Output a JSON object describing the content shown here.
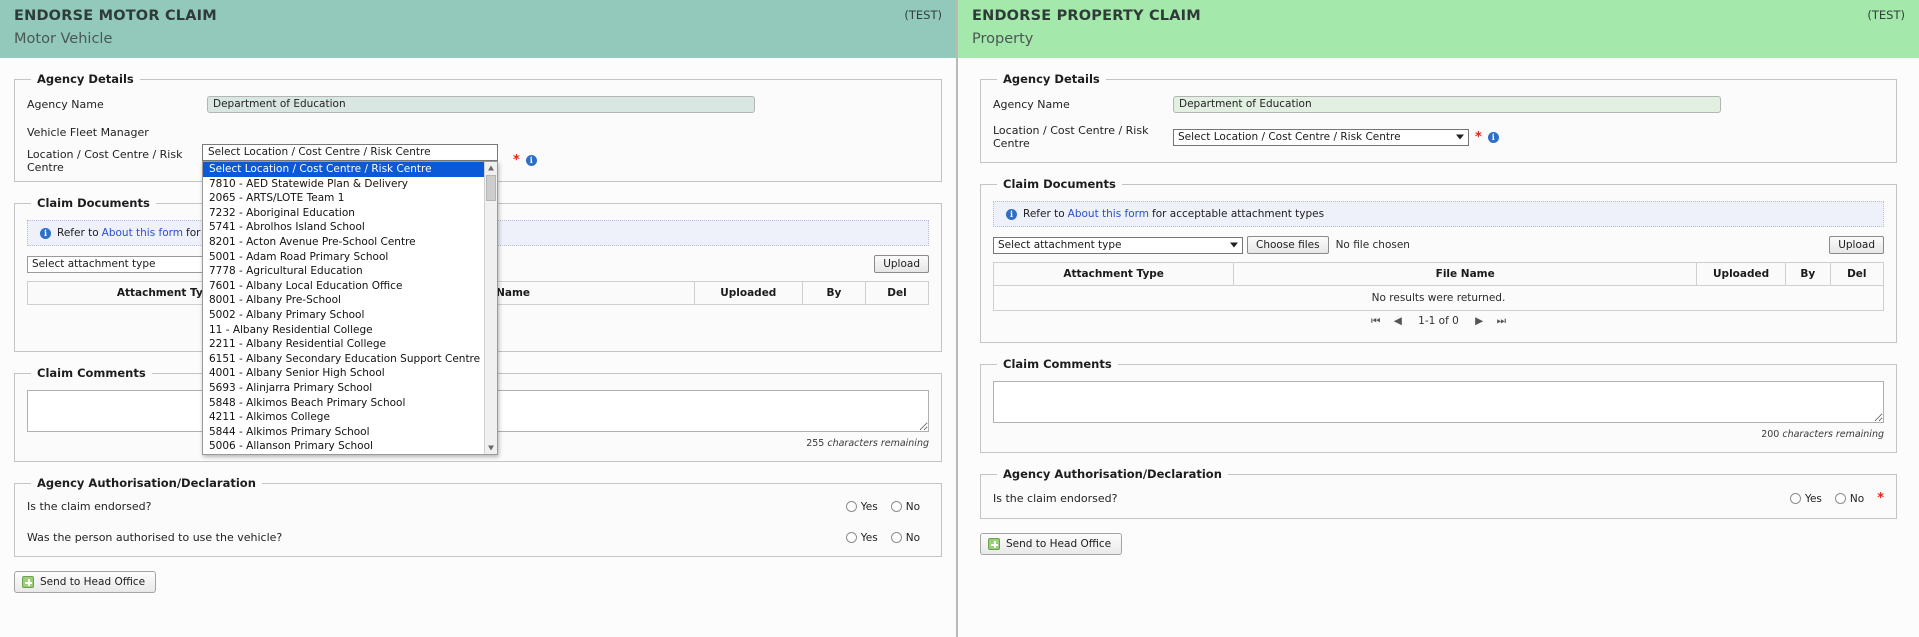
{
  "motor": {
    "banner": {
      "title": "ENDORSE MOTOR CLAIM",
      "subtitle": "Motor Vehicle",
      "test": "(TEST)"
    },
    "agency_details": {
      "legend": "Agency Details",
      "agency_name_label": "Agency Name",
      "agency_name_value": "Department of Education",
      "fleet_manager_label": "Vehicle Fleet Manager",
      "fleet_manager_value": "",
      "location_label": "Location / Cost Centre / Risk Centre",
      "location_value": "Select Location / Cost Centre / Risk Centre",
      "required_marker": "*",
      "info_icon_label": "i"
    },
    "location_dropdown": {
      "closed_value": "Select Location / Cost Centre / Risk Centre",
      "options": [
        "Select Location / Cost Centre / Risk Centre",
        "7810 - AED Statewide Plan & Delivery",
        "2065 - ARTS/LOTE Team 1",
        "7232 - Aboriginal Education",
        "5741 - Abrolhos Island School",
        "8201 - Acton Avenue Pre-School Centre",
        "5001 - Adam Road Primary School",
        "7778 - Agricultural Education",
        "7601 - Albany Local Education Office",
        "8001 - Albany Pre-School",
        "5002 - Albany Primary School",
        "11 - Albany Residential College",
        "2211 - Albany Residential College",
        "6151 - Albany Secondary Education Support Centre",
        "4001 - Albany Senior High School",
        "5693 - Alinjarra Primary School",
        "5848 - Alkimos Beach Primary School",
        "4211 - Alkimos College",
        "5844 - Alkimos Primary School",
        "5006 - Allanson Primary School"
      ],
      "selected_index": 0
    },
    "claim_documents": {
      "legend": "Claim Documents",
      "info_prefix": "Refer to",
      "info_link": "About this form",
      "info_suffix": "for acceptable attachment types",
      "attachment_select_value": "Select attachment type",
      "upload_button": "Upload",
      "columns": [
        "Attachment Type",
        "File Name",
        "Uploaded",
        "By",
        "Del"
      ]
    },
    "claim_comments": {
      "legend": "Claim Comments",
      "value": "",
      "char_count": "255",
      "char_count_suffix": "characters remaining"
    },
    "declaration": {
      "legend": "Agency Authorisation/Declaration",
      "questions": [
        {
          "label": "Is the claim endorsed?",
          "yes": "Yes",
          "no": "No"
        },
        {
          "label": "Was the person authorised to use the vehicle?",
          "yes": "Yes",
          "no": "No"
        }
      ]
    },
    "send_button": "Send to Head Office"
  },
  "property": {
    "banner": {
      "title": "ENDORSE PROPERTY CLAIM",
      "subtitle": "Property",
      "test": "(TEST)"
    },
    "agency_details": {
      "legend": "Agency Details",
      "agency_name_label": "Agency Name",
      "agency_name_value": "Department of Education",
      "location_label": "Location / Cost Centre / Risk Centre",
      "location_value": "Select Location / Cost Centre / Risk Centre",
      "required_marker": "*",
      "info_icon_label": "i"
    },
    "claim_documents": {
      "legend": "Claim Documents",
      "info_prefix": "Refer to",
      "info_link": "About this form",
      "info_suffix": "for acceptable attachment types",
      "attachment_select_value": "Select attachment type",
      "choose_files_button": "Choose files",
      "no_file_text": "No file chosen",
      "upload_button": "Upload",
      "columns": [
        "Attachment Type",
        "File Name",
        "Uploaded",
        "By",
        "Del"
      ],
      "empty_message": "No results were returned.",
      "pager_range": "1-1 of 0"
    },
    "claim_comments": {
      "legend": "Claim Comments",
      "value": "",
      "char_count": "200",
      "char_count_suffix": "characters remaining"
    },
    "declaration": {
      "legend": "Agency Authorisation/Declaration",
      "questions": [
        {
          "label": "Is the claim endorsed?",
          "yes": "Yes",
          "no": "No"
        }
      ],
      "required_marker": "*"
    },
    "send_button": "Send to Head Office"
  }
}
